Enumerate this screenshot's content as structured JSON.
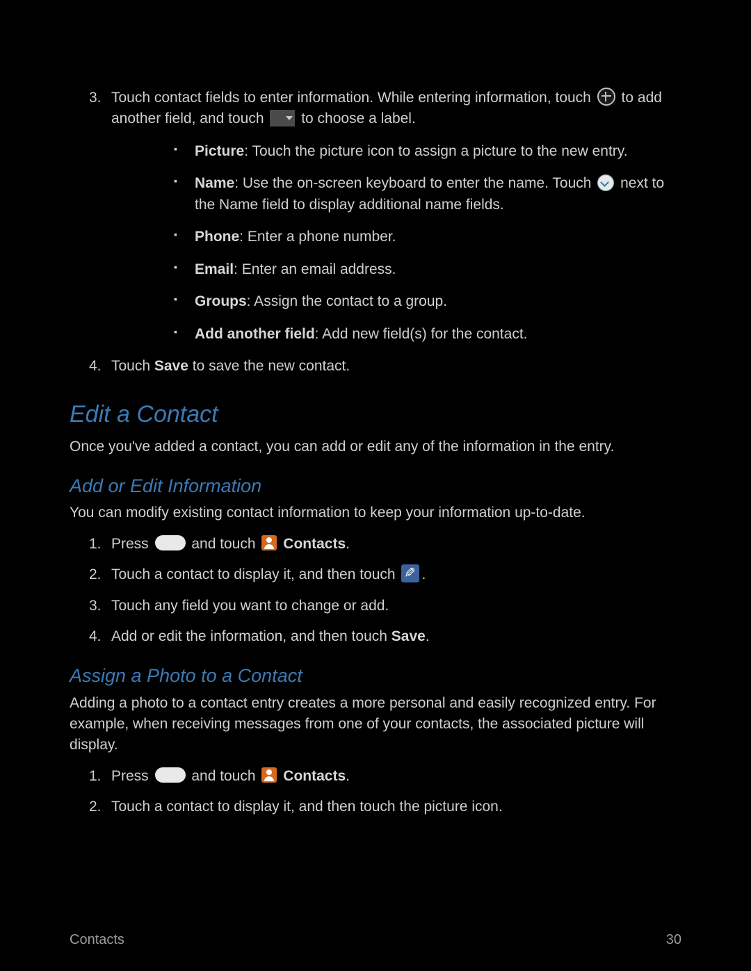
{
  "section_a": {
    "step3_a": "Touch contact fields to enter information. While entering information, touch ",
    "step3_b": " to add another field, and touch ",
    "step3_c": " to choose a label.",
    "bullets": {
      "picture": {
        "label": "Picture",
        "text": ": Touch the picture icon to assign a picture to the new entry."
      },
      "name": {
        "label": "Name",
        "text_a": ": Use the on-screen keyboard to enter the name. Touch ",
        "text_b": " next to the Name field to display additional name fields."
      },
      "phone": {
        "label": "Phone",
        "text": ": Enter a phone number."
      },
      "email": {
        "label": "Email",
        "text": ": Enter an email address."
      },
      "groups": {
        "label": "Groups",
        "text": ": Assign the contact to a group."
      },
      "another": {
        "label": "Add another field",
        "text": ": Add new field(s) for the contact."
      }
    },
    "step4_a": "Touch ",
    "step4_bold": "Save",
    "step4_b": " to save the new contact."
  },
  "edit": {
    "heading": "Edit a Contact",
    "intro": "Once you've added a contact, you can add or edit any of the information in the entry."
  },
  "addedit": {
    "heading": "Add or Edit Information",
    "intro": "You can modify existing contact information to keep your information up-to-date.",
    "s1_a": "Press ",
    "s1_b": " and touch ",
    "s1_bold": "Contacts",
    "s1_c": ".",
    "s2_a": "Touch a contact to display it, and then touch ",
    "s2_b": ".",
    "s3": "Touch any field you want to change or add.",
    "s4_a": "Add or edit the information, and then touch ",
    "s4_bold": "Save",
    "s4_b": "."
  },
  "photo": {
    "heading": "Assign a Photo to a Contact",
    "intro": "Adding a photo to a contact entry creates a more personal and easily recognized entry. For example, when receiving messages from one of your contacts, the associated picture will display.",
    "s1_a": "Press ",
    "s1_b": " and touch ",
    "s1_bold": "Contacts",
    "s1_c": ".",
    "s2": "Touch a contact to display it, and then touch the picture icon."
  },
  "footer": {
    "section": "Contacts",
    "page": "30"
  }
}
